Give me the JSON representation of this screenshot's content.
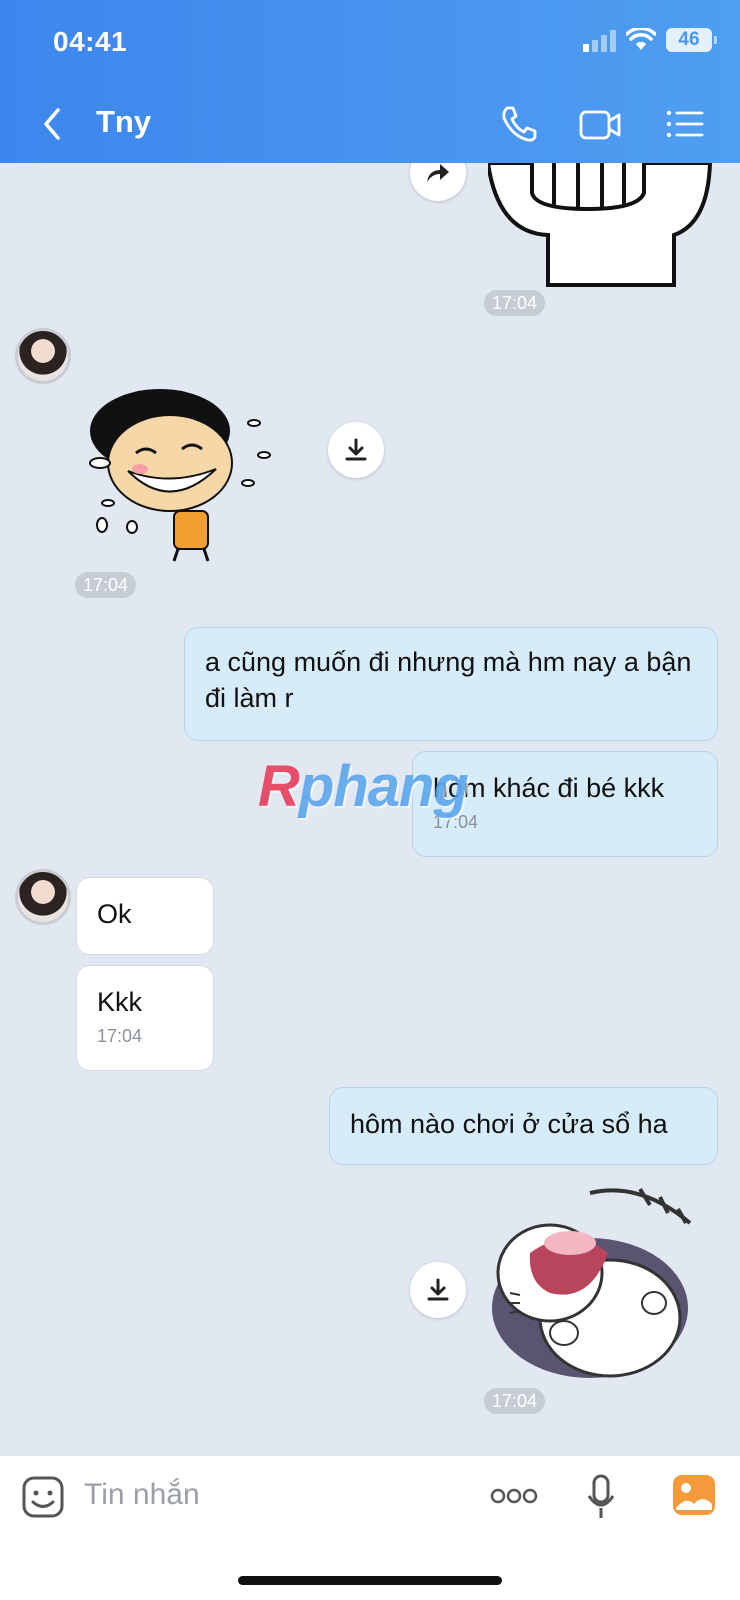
{
  "status_bar": {
    "time": "04:41",
    "battery": "46"
  },
  "header": {
    "title": "Tny"
  },
  "messages": {
    "ts1": "17:04",
    "ts2": "17:04",
    "m1": "a cũng muốn đi nhưng mà hm nay a bận đi làm r",
    "m2": "hôm khác đi bé kkk",
    "m2_time": "17:04",
    "r1": "Ok",
    "r2": "Kkk",
    "r2_time": "17:04",
    "m3": "hôm nào chơi ở cửa sổ ha",
    "ts3": "17:04"
  },
  "watermark": {
    "r": "R",
    "rest": "phang"
  },
  "input": {
    "placeholder": "Tin nhắn"
  },
  "icons": [
    "back-icon",
    "phone-icon",
    "video-icon",
    "menu-icon",
    "forward-icon",
    "download-icon",
    "emoji-icon",
    "more-icon",
    "mic-icon",
    "gallery-icon"
  ],
  "colors": {
    "header_start": "#3d86ee",
    "header_end": "#4f9ff0",
    "sent_bubble": "#d6ecfb",
    "chat_bg": "#e2e8f1"
  }
}
